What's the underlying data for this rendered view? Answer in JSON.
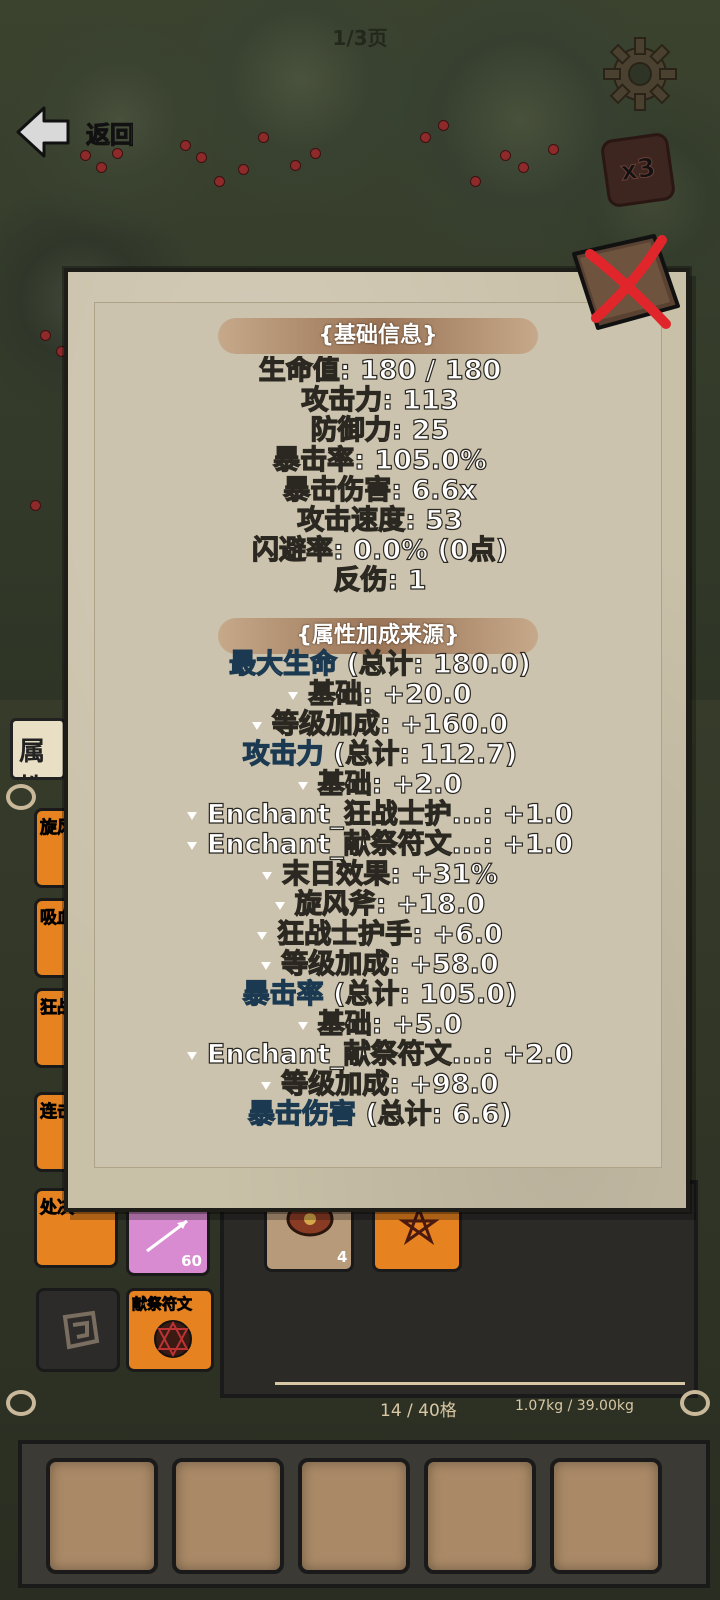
{
  "header": {
    "page_indicator": "1/3页",
    "back_label": "返回",
    "speed_label": "x3"
  },
  "left_panel": {
    "tab_label": "属性",
    "items": [
      {
        "label": "旋风"
      },
      {
        "label": "吸血"
      },
      {
        "label": "狂战"
      },
      {
        "label": "连击"
      },
      {
        "label": "处决"
      }
    ],
    "arrow_item_count": "60",
    "rune_item_label": "献祭符文"
  },
  "inventory": {
    "shield_count": "4",
    "slots_text": "14 / 40格",
    "weight_text": "1.07kg / 39.00kg"
  },
  "stats": {
    "base_header": "{基础信息}",
    "base_lines": [
      "生命值: 180 / 180",
      "攻击力: 113",
      "防御力: 25",
      "暴击率: 105.0%",
      "暴击伤害: 6.6x",
      "攻击速度: 53",
      "闪避率: 0.0% (0点)",
      "反伤: 1"
    ],
    "source_header": "{属性加成来源}",
    "source_lines": [
      {
        "type": "stat",
        "name": "最大生命",
        "total": " (总计: 180.0)"
      },
      {
        "type": "sub",
        "text": "基础: +20.0"
      },
      {
        "type": "sub",
        "text": "等级加成: +160.0"
      },
      {
        "type": "stat",
        "name": "攻击力",
        "total": " (总计: 112.7)"
      },
      {
        "type": "sub",
        "text": "基础: +2.0"
      },
      {
        "type": "sub",
        "text": "Enchant_狂战士护...: +1.0"
      },
      {
        "type": "sub",
        "text": "Enchant_献祭符文...: +1.0"
      },
      {
        "type": "sub",
        "text": "末日效果: +31%"
      },
      {
        "type": "sub",
        "text": "旋风斧: +18.0"
      },
      {
        "type": "sub",
        "text": "狂战士护手: +6.0"
      },
      {
        "type": "sub",
        "text": "等级加成: +58.0"
      },
      {
        "type": "stat",
        "name": "暴击率",
        "total": " (总计: 105.0)"
      },
      {
        "type": "sub",
        "text": "基础: +5.0"
      },
      {
        "type": "sub",
        "text": "Enchant_献祭符文...: +2.0"
      },
      {
        "type": "sub",
        "text": "等级加成: +98.0"
      },
      {
        "type": "stat",
        "name": "暴击伤害",
        "total": " (总计: 6.6)"
      }
    ]
  }
}
